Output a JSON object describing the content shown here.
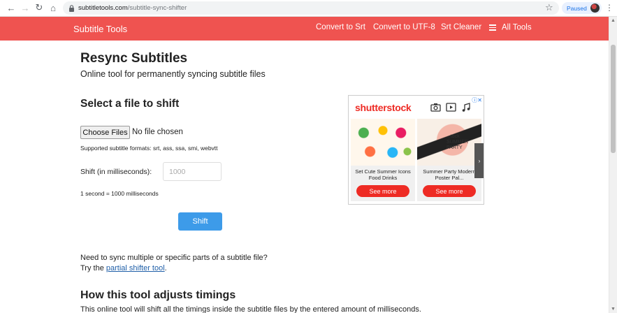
{
  "browser": {
    "url_host": "subtitletools.com",
    "url_path": "/subtitle-sync-shifter",
    "profile_status": "Paused"
  },
  "site": {
    "brand": "Subtitle Tools",
    "nav": [
      "Convert to Srt",
      "Convert to UTF-8",
      "Srt Cleaner",
      "All Tools"
    ]
  },
  "page": {
    "title": "Resync Subtitles",
    "subtitle": "Online tool for permanently syncing subtitle files",
    "section_title": "Select a file to shift",
    "file_button": "Choose Files",
    "file_status": "No file chosen",
    "formats_note": "Supported subtitle formats: srt, ass, ssa, smi, webvtt",
    "shift_label": "Shift (in milliseconds):",
    "shift_placeholder": "1000",
    "ms_note": "1 second = 1000 milliseconds",
    "shift_button": "Shift",
    "sync_note_line1": "Need to sync multiple or specific parts of a subtitle file?",
    "sync_note_prefix": "Try the ",
    "sync_note_link": "partial shifter tool",
    "sync_note_suffix": ".",
    "how_title": "How this tool adjusts timings",
    "how_text": "This online tool will shift all the timings inside the subtitle files by the entered amount of milliseconds."
  },
  "ad": {
    "logo": "shutterstock",
    "info": "ⓘ✕",
    "cards": [
      {
        "caption": "Set Cute Summer Icons Food Drinks",
        "button": "See more"
      },
      {
        "caption": "Summer Party Modern Poster Pal...",
        "button": "See more",
        "image_text": "...tock SUMMER PARTY"
      }
    ]
  },
  "colors": {
    "nav_bg": "#ef5350",
    "primary_button": "#3d9be9",
    "link": "#1f5fa8",
    "ad_red": "#ee2b24"
  }
}
